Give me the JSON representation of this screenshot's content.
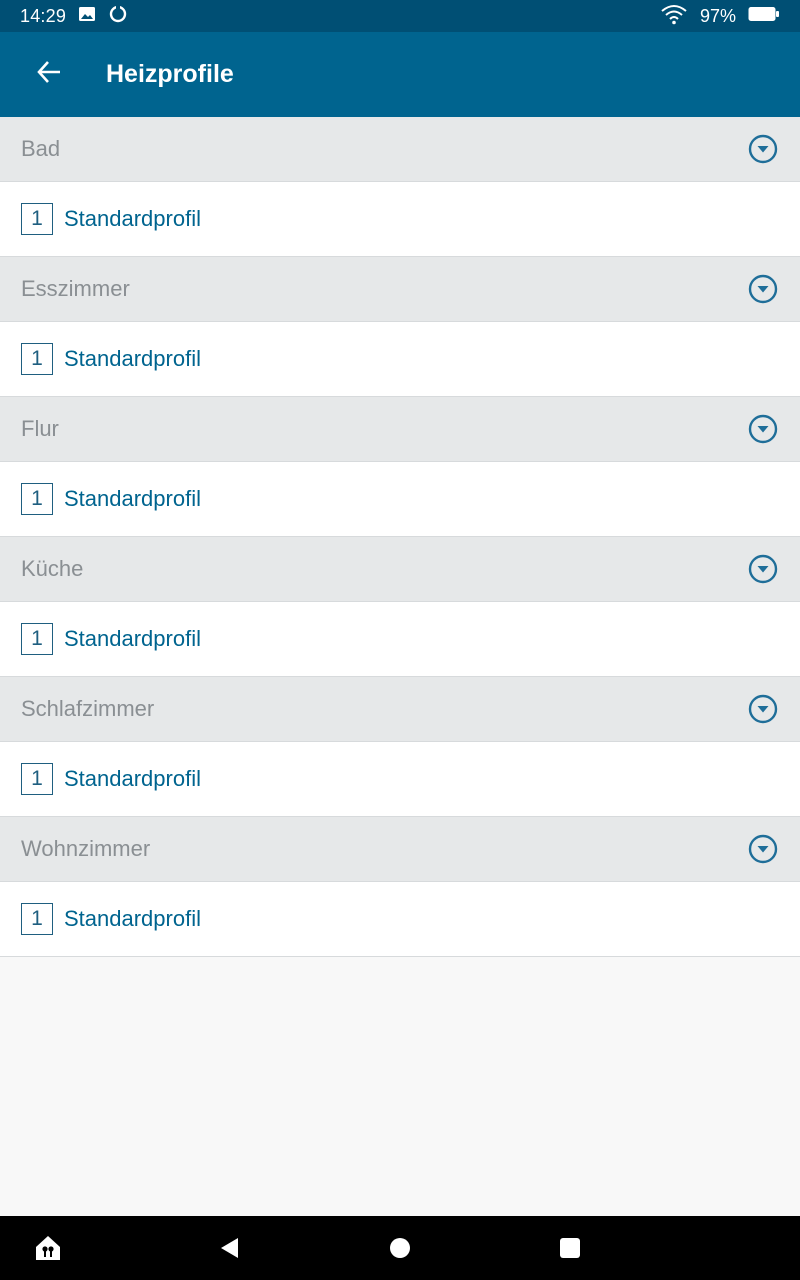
{
  "status_bar": {
    "time": "14:29",
    "battery": "97%",
    "icons": [
      "image-icon",
      "sync-icon",
      "wifi-icon",
      "battery-icon"
    ]
  },
  "app_bar": {
    "title": "Heizprofile",
    "back_icon": "arrow-back-icon"
  },
  "colors": {
    "status_bar": "#004f74",
    "app_bar": "#00648f",
    "room_header_bg": "#e6e8e9",
    "room_name_text": "#8a8f93",
    "profile_text": "#00648f",
    "accent": "#1f6e99"
  },
  "rooms": [
    {
      "name": "Bad",
      "profile_number": "1",
      "profile_name": "Standardprofil"
    },
    {
      "name": "Esszimmer",
      "profile_number": "1",
      "profile_name": "Standardprofil"
    },
    {
      "name": "Flur",
      "profile_number": "1",
      "profile_name": "Standardprofil"
    },
    {
      "name": "Küche",
      "profile_number": "1",
      "profile_name": "Standardprofil"
    },
    {
      "name": "Schlafzimmer",
      "profile_number": "1",
      "profile_name": "Standardprofil"
    },
    {
      "name": "Wohnzimmer",
      "profile_number": "1",
      "profile_name": "Standardprofil"
    }
  ],
  "nav_bar": {
    "icons": [
      "home-app-icon",
      "back-triangle-icon",
      "home-circle-icon",
      "recents-square-icon"
    ]
  }
}
